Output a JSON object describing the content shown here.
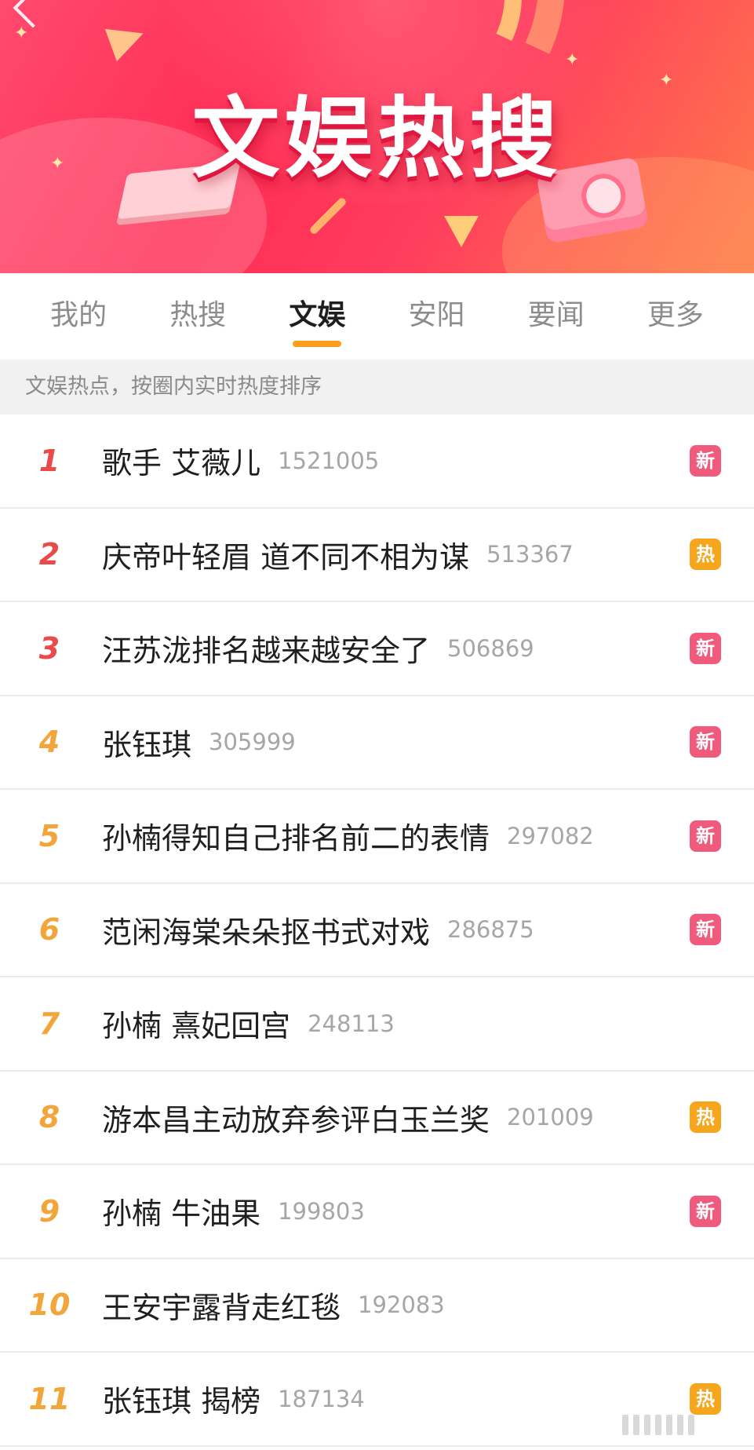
{
  "banner": {
    "title": "文娱热搜"
  },
  "tabs": [
    {
      "label": "我的",
      "active": false
    },
    {
      "label": "热搜",
      "active": false
    },
    {
      "label": "文娱",
      "active": true
    },
    {
      "label": "安阳",
      "active": false
    },
    {
      "label": "要闻",
      "active": false
    },
    {
      "label": "更多",
      "active": false
    }
  ],
  "notice": "文娱热点，按圈内实时热度排序",
  "items": [
    {
      "rank": "1",
      "title": "歌手 艾薇儿",
      "count": "1521005",
      "badge": "新",
      "badge_type": "new"
    },
    {
      "rank": "2",
      "title": "庆帝叶轻眉 道不同不相为谋",
      "count": "513367",
      "badge": "热",
      "badge_type": "hot"
    },
    {
      "rank": "3",
      "title": "汪苏泷排名越来越安全了",
      "count": "506869",
      "badge": "新",
      "badge_type": "new"
    },
    {
      "rank": "4",
      "title": "张钰琪",
      "count": "305999",
      "badge": "新",
      "badge_type": "new"
    },
    {
      "rank": "5",
      "title": "孙楠得知自己排名前二的表情",
      "count": "297082",
      "badge": "新",
      "badge_type": "new"
    },
    {
      "rank": "6",
      "title": "范闲海棠朵朵抠书式对戏",
      "count": "286875",
      "badge": "新",
      "badge_type": "new"
    },
    {
      "rank": "7",
      "title": "孙楠 熹妃回宫",
      "count": "248113",
      "badge": "",
      "badge_type": ""
    },
    {
      "rank": "8",
      "title": "游本昌主动放弃参评白玉兰奖",
      "count": "201009",
      "badge": "热",
      "badge_type": "hot"
    },
    {
      "rank": "9",
      "title": "孙楠 牛油果",
      "count": "199803",
      "badge": "新",
      "badge_type": "new"
    },
    {
      "rank": "10",
      "title": "王安宇露背走红毯",
      "count": "192083",
      "badge": "",
      "badge_type": ""
    },
    {
      "rank": "11",
      "title": "张钰琪 揭榜",
      "count": "187134",
      "badge": "热",
      "badge_type": "hot"
    }
  ],
  "colors": {
    "accent": "#ff9d1c",
    "rank_top": "#e94a4a",
    "rank_other": "#f2a53a",
    "badge_new": "#ef5a7d",
    "badge_hot": "#f6a61d"
  }
}
